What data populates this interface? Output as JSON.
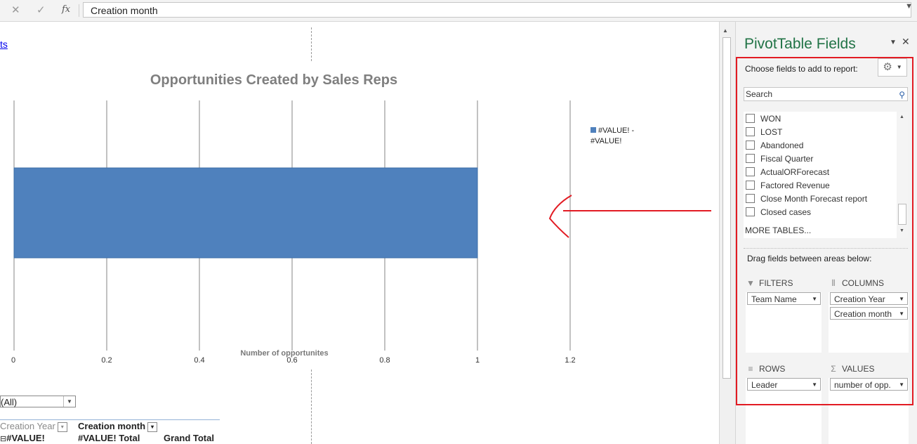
{
  "formula_bar": {
    "cancel_icon": "close-icon",
    "enter_icon": "checkmark-icon",
    "fx_label": "fx",
    "value": "Creation month"
  },
  "sheet": {
    "link_text": "ts",
    "chart_data": {
      "type": "bar",
      "orientation": "horizontal",
      "title": "Opportunities Created by Sales Reps",
      "xlabel": "Number of opportunites",
      "ylabel": "",
      "categories": [
        ""
      ],
      "series": [
        {
          "name": "#VALUE! - #VALUE!",
          "values": [
            1
          ],
          "color": "#4f81bd"
        }
      ],
      "xlim": [
        0,
        1.2
      ],
      "xticks": [
        "0",
        "0.2",
        "0.4",
        "0.6",
        "0.8",
        "1",
        "1.2"
      ],
      "grid": true,
      "legend": "right",
      "legend_lines": [
        "#VALUE! -",
        "#VALUE!"
      ]
    },
    "annotation_color": "#e21b23",
    "pivot": {
      "filter_value": "(All)",
      "col_header_1": "Creation Year",
      "col_header_2": "Creation month",
      "row_label": "#VALUE!",
      "total_label": "#VALUE! Total",
      "grand_total_label": "Grand Total",
      "expand_symbol": "⊟"
    }
  },
  "pane": {
    "title": "PivotTable Fields",
    "choose_label": "Choose fields to add to report:",
    "search_placeholder": "Search",
    "fields": [
      "WON",
      "LOST",
      "Abandoned",
      "Fiscal Quarter",
      "ActualORForecast",
      "Factored Revenue",
      "Close Month Forecast report",
      "Closed cases"
    ],
    "more_tables": "MORE TABLES...",
    "drag_label": "Drag fields between areas below:",
    "filters_label": "FILTERS",
    "columns_label": "COLUMNS",
    "rows_label": "ROWS",
    "values_label": "VALUES",
    "filters_items": [
      "Team Name"
    ],
    "columns_items": [
      "Creation Year",
      "Creation month"
    ],
    "rows_items": [
      "Leader"
    ],
    "values_items": [
      "number of opp."
    ],
    "accent_color": "#217346"
  }
}
